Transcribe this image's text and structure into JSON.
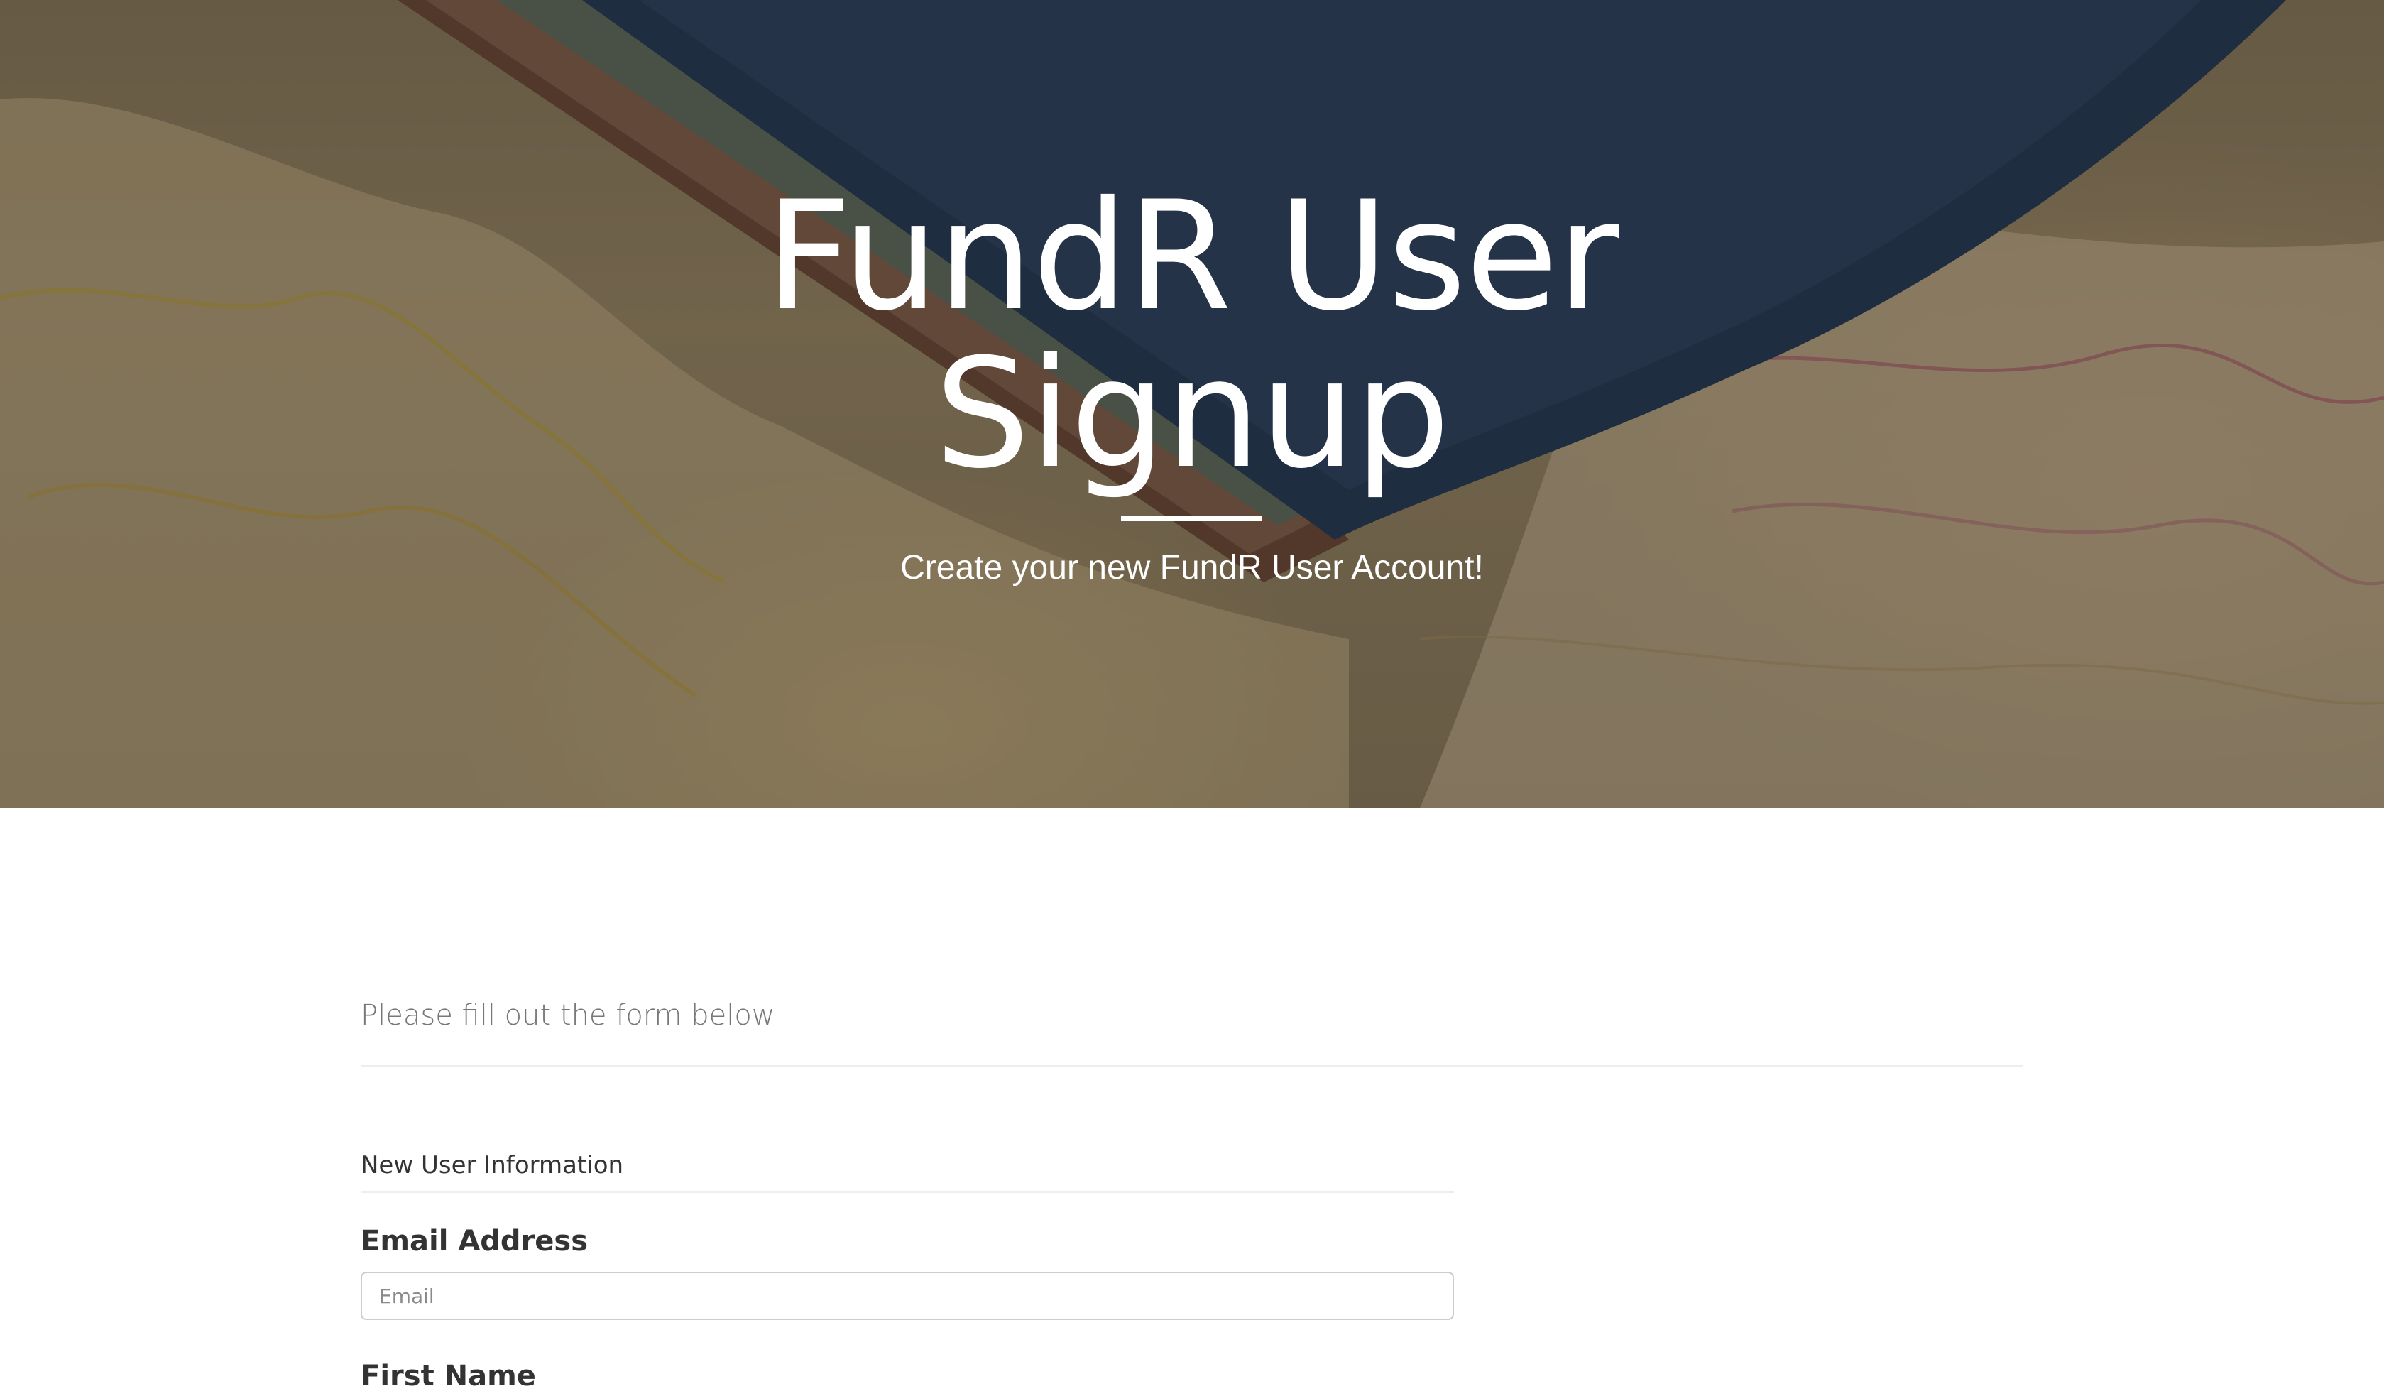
{
  "hero": {
    "title_line1": "FundR User",
    "title_line2": "Signup",
    "subtitle": "Create your new FundR User Account!"
  },
  "form": {
    "intro": "Please fill out the form below",
    "section_title": "New User Information",
    "fields": {
      "email": {
        "label": "Email Address",
        "placeholder": "Email",
        "value": ""
      },
      "first_name": {
        "label": "First Name"
      }
    }
  },
  "colors": {
    "text_heading": "#333333",
    "text_muted": "#777777",
    "divider": "#eeeeee",
    "input_border": "#cccccc"
  }
}
